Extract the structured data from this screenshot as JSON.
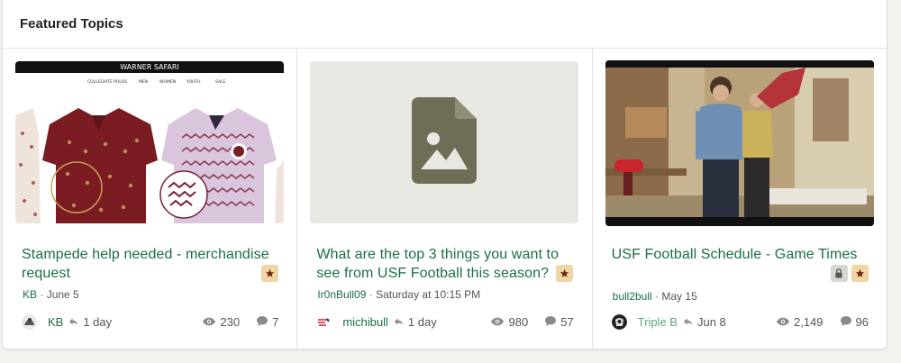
{
  "section": {
    "title": "Featured Topics"
  },
  "topics": [
    {
      "title": "Stampede help needed - merchandise request",
      "meta_user": "KB",
      "meta_time": "June 5",
      "last_user": "KB",
      "last_ago": "1 day",
      "views": "230",
      "replies": "7",
      "thumb_header": "WARNER SAFARI",
      "thumb_nav": [
        "COLLEGIATE POLOS",
        "MEN",
        "WOMEN",
        "YOUTH",
        "SALE"
      ]
    },
    {
      "title": "What are the top 3 things you want to see from USF Football this season?",
      "meta_user": "Ir0nBull09",
      "meta_time": "Saturday at 10:15 PM",
      "last_user": "michibull",
      "last_ago": "1 day",
      "views": "980",
      "replies": "57"
    },
    {
      "title": "USF Football Schedule - Game Times",
      "meta_user": "bull2bull",
      "meta_time": "May 15",
      "last_user": "Triple B",
      "last_ago": "Jun 8",
      "views": "2,149",
      "replies": "96"
    }
  ],
  "separator": "·",
  "icons": [
    "star-pin-icon",
    "lock-icon",
    "reply-icon",
    "eye-icon",
    "comment-icon",
    "image-file-icon"
  ],
  "colors": {
    "link": "#1b6e47",
    "pin_badge": "#f0d6a4",
    "lock_badge": "#d7d7d2",
    "placeholder_bg": "#e8e8e3",
    "placeholder_icon": "#6f6d55"
  }
}
